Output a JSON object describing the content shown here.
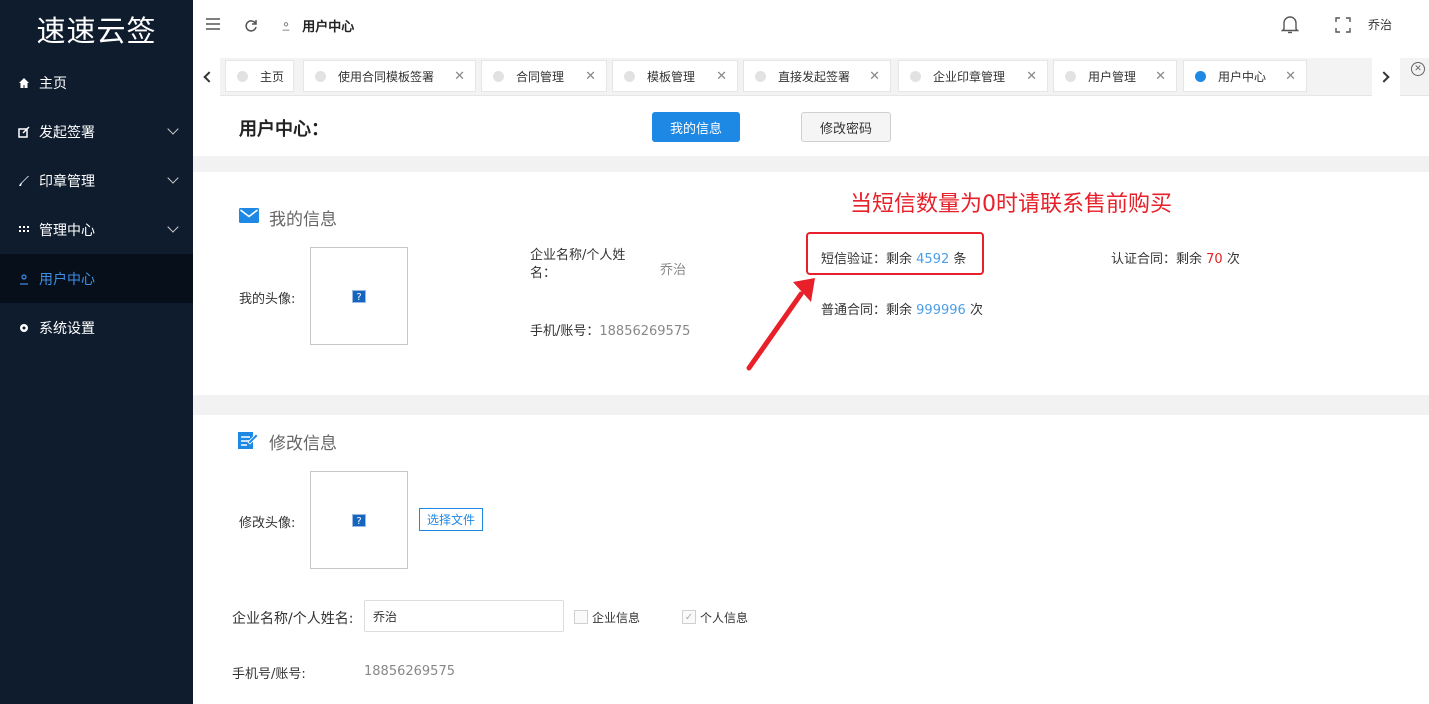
{
  "sidebar": {
    "logo": "速速云签",
    "items": [
      {
        "label": "主页",
        "icon": "home-icon"
      },
      {
        "label": "发起签署",
        "icon": "edit-icon"
      },
      {
        "label": "印章管理",
        "icon": "brush-icon"
      },
      {
        "label": "管理中心",
        "icon": "grid-icon"
      },
      {
        "label": "用户中心",
        "icon": "user-icon"
      },
      {
        "label": "系统设置",
        "icon": "gear-icon"
      }
    ]
  },
  "topbar": {
    "breadcrumb": "用户中心",
    "user_name": "乔治"
  },
  "tabs": [
    {
      "label": "主页"
    },
    {
      "label": "使用合同模板签署"
    },
    {
      "label": "合同管理"
    },
    {
      "label": "模板管理"
    },
    {
      "label": "直接发起签署"
    },
    {
      "label": "企业印章管理"
    },
    {
      "label": "用户管理"
    },
    {
      "label": "用户中心"
    }
  ],
  "header": {
    "title": "用户中心：",
    "my_info_button": "我的信息",
    "change_password_button": "修改密码"
  },
  "my_info": {
    "section_title": "我的信息",
    "avatar_label": "我的头像:",
    "company_label_line1": "企业名称/个人姓",
    "company_label_line2": "名：",
    "company_value": "乔治",
    "phone_label": "手机/账号：",
    "phone_value": "18856269575",
    "sms_label": "短信验证：剩余",
    "sms_count": "4592",
    "sms_unit": "条",
    "normal_label": "普通合同：剩余",
    "normal_count": "999996",
    "normal_unit": "次",
    "certified_label": "认证合同：剩余",
    "certified_count": "70",
    "certified_unit": "次",
    "annotation": "当短信数量为0时请联系售前购买",
    "colors": {
      "accent": "#1e88e5",
      "annotation": "#e8202a",
      "count_blue": "#4c9ee8",
      "count_red": "#e02424"
    }
  },
  "edit_info": {
    "section_title": "修改信息",
    "avatar_label": "修改头像:",
    "file_button": "选择文件",
    "company_label": "企业名称/个人姓名:",
    "company_value": "乔治",
    "company_checkbox": "企业信息",
    "personal_checkbox": "个人信息",
    "phone_label": "手机号/账号:",
    "phone_value": "18856269575"
  },
  "broken_image_glyph": "?"
}
